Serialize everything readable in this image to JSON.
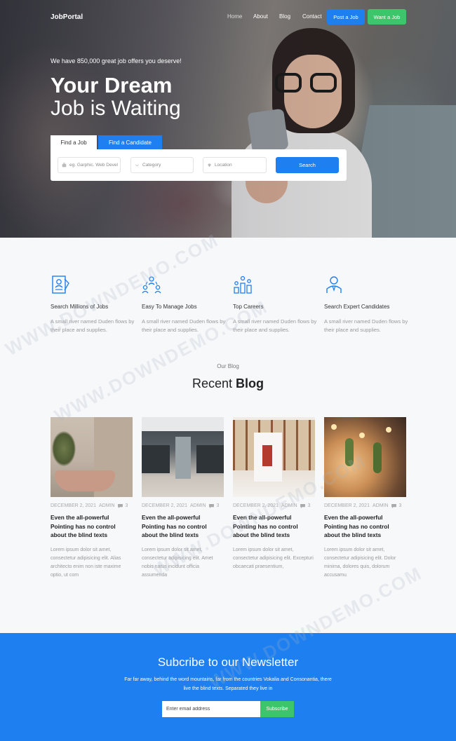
{
  "nav": {
    "brand": "JobPortal",
    "links": [
      "Home",
      "About",
      "Blog",
      "Contact"
    ],
    "post_job": "Post a Job",
    "want_job": "Want a Job"
  },
  "hero": {
    "subtitle": "We have 850,000 great job offers you deserve!",
    "title_line1": "Your Dream",
    "title_line2": "Job is Waiting",
    "tabs": [
      "Find a Job",
      "Find a Candidate"
    ],
    "active_tab": "Find a Job",
    "search": {
      "keyword_placeholder": "eg. Garphic. Web Devel",
      "category_placeholder": "Category",
      "location_placeholder": "Location",
      "button": "Search"
    }
  },
  "features": [
    {
      "icon": "resume-icon",
      "title": "Search Millions of Jobs",
      "desc": "A small river named Duden flows by their place and supplies."
    },
    {
      "icon": "team-network-icon",
      "title": "Easy To Manage Jobs",
      "desc": "A small river named Duden flows by their place and supplies."
    },
    {
      "icon": "career-growth-icon",
      "title": "Top Careers",
      "desc": "A small river named Duden flows by their place and supplies."
    },
    {
      "icon": "candidate-icon",
      "title": "Search Expert Candidates",
      "desc": "A small river named Duden flows by their place and supplies."
    }
  ],
  "blog": {
    "eyebrow": "Our Blog",
    "heading_light": "Recent",
    "heading_bold": "Blog",
    "posts": [
      {
        "date": "DECEMBER 2, 2021",
        "author": "ADMIN",
        "comments": "3",
        "title": "Even the all-powerful Pointing has no control about the blind texts",
        "excerpt": "Lorem ipsum dolor sit amet, consectetur adipisicing elit. Alias architecto enim non iste maxime optio, ut com"
      },
      {
        "date": "DECEMBER 2, 2021",
        "author": "ADMIN",
        "comments": "3",
        "title": "Even the all-powerful Pointing has no control about the blind texts",
        "excerpt": "Lorem ipsum dolor sit amet, consectetur adipisicing elit. Amet nobis natus incidunt officia assumenda"
      },
      {
        "date": "DECEMBER 2, 2021",
        "author": "ADMIN",
        "comments": "3",
        "title": "Even the all-powerful Pointing has no control about the blind texts",
        "excerpt": "Lorem ipsum dolor sit amet, consectetur adipisicing elit. Excepturi obcaecati praesentium,"
      },
      {
        "date": "DECEMBER 2, 2021",
        "author": "ADMIN",
        "comments": "3",
        "title": "Even the all-powerful Pointing has no control about the blind texts",
        "excerpt": "Lorem ipsum dolor sit amet, consectetur adipisicing elit. Dolor minima, dolores quis, dolorum accusamu"
      }
    ]
  },
  "newsletter": {
    "title": "Subcribe to our Newsletter",
    "text": "Far far away, behind the word mountains, far from the countries Vokalia and Consonantia, there live the blind texts. Separated they live in",
    "placeholder": "Enter email address",
    "button": "Subscribe"
  },
  "colors": {
    "primary": "#1e7ff0",
    "accent_green": "#3dc56b"
  }
}
